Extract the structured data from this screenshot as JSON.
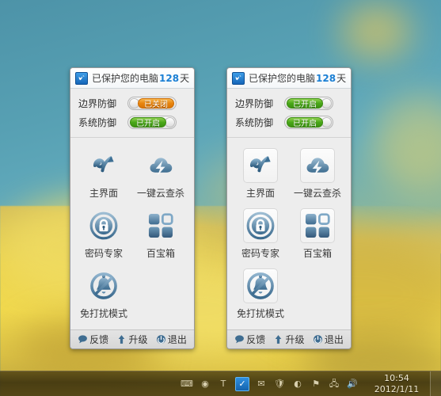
{
  "desktop": {
    "wallpaper_sky_color": "#57a0b3",
    "wallpaper_field_color": "#ecd44e"
  },
  "panels": [
    {
      "id": "panel-left",
      "header": {
        "icon": "app-shield-icon",
        "prefix": "已保护您的电脑",
        "days": "128",
        "suffix": "天"
      },
      "defense": [
        {
          "label": "边界防御",
          "state": "off",
          "state_label": "已关闭"
        },
        {
          "label": "系统防御",
          "state": "on",
          "state_label": "已开启"
        }
      ],
      "tiles": [
        {
          "icon": "home-arrow-icon",
          "label": "主界面",
          "hovered": false
        },
        {
          "icon": "cloud-scan-icon",
          "label": "一键云查杀",
          "hovered": false
        },
        {
          "icon": "password-lock-icon",
          "label": "密码专家",
          "hovered": false
        },
        {
          "icon": "toolbox-grid-icon",
          "label": "百宝箱",
          "hovered": false
        },
        {
          "icon": "do-not-disturb-icon",
          "label": "免打扰模式",
          "hovered": false
        }
      ],
      "footer": [
        {
          "icon": "speech-bubble-icon",
          "label": "反馈"
        },
        {
          "icon": "up-arrow-icon",
          "label": "升级"
        },
        {
          "icon": "power-icon",
          "label": "退出"
        }
      ]
    },
    {
      "id": "panel-right",
      "header": {
        "icon": "app-shield-icon",
        "prefix": "已保护您的电脑",
        "days": "128",
        "suffix": "天"
      },
      "defense": [
        {
          "label": "边界防御",
          "state": "on",
          "state_label": "已开启"
        },
        {
          "label": "系统防御",
          "state": "on",
          "state_label": "已开启"
        }
      ],
      "tiles": [
        {
          "icon": "home-arrow-icon",
          "label": "主界面",
          "hovered": true
        },
        {
          "icon": "cloud-scan-icon",
          "label": "一键云查杀",
          "hovered": true
        },
        {
          "icon": "password-lock-icon",
          "label": "密码专家",
          "hovered": true
        },
        {
          "icon": "toolbox-grid-icon",
          "label": "百宝箱",
          "hovered": true
        },
        {
          "icon": "do-not-disturb-icon",
          "label": "免打扰模式",
          "hovered": true
        }
      ],
      "footer": [
        {
          "icon": "speech-bubble-icon",
          "label": "反馈"
        },
        {
          "icon": "up-arrow-icon",
          "label": "升级"
        },
        {
          "icon": "power-icon",
          "label": "退出"
        }
      ]
    }
  ],
  "taskbar": {
    "tray": [
      {
        "name": "keyboard-icon",
        "glyph": "⌨"
      },
      {
        "name": "nvidia-icon",
        "glyph": "◉"
      },
      {
        "name": "text-tool-icon",
        "glyph": "T"
      },
      {
        "name": "security-app-icon",
        "glyph": "✓",
        "active": true
      },
      {
        "name": "mail-icon",
        "glyph": "✉"
      },
      {
        "name": "shield-icon",
        "glyph": "🛡"
      },
      {
        "name": "browser-icon",
        "glyph": "◐"
      },
      {
        "name": "action-center-flag-icon",
        "glyph": "⚑"
      },
      {
        "name": "network-icon",
        "glyph": "🖧"
      },
      {
        "name": "volume-icon",
        "glyph": "🔊"
      }
    ],
    "clock": {
      "time": "10:54",
      "date": "2012/1/11"
    }
  }
}
